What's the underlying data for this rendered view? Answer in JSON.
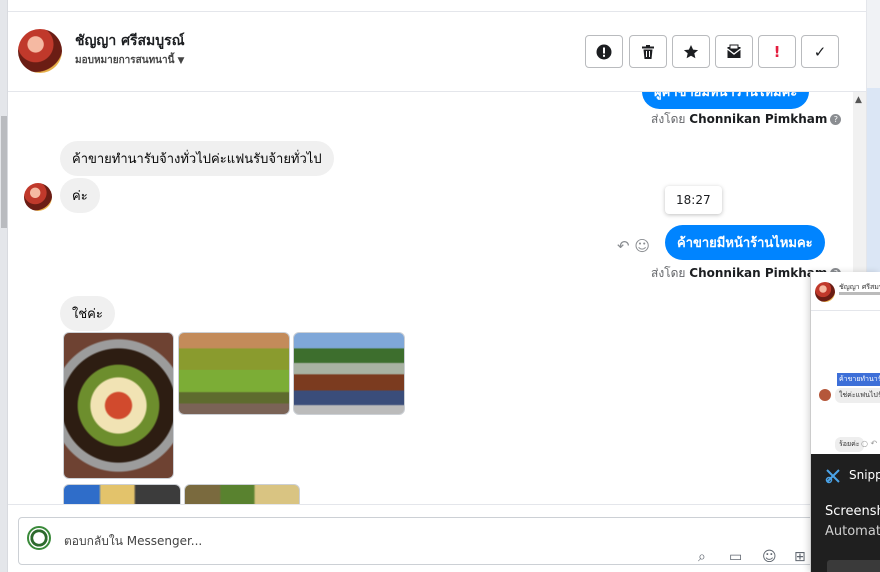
{
  "header": {
    "contact_name": "ชัญญา ศรีสมบูรณ์",
    "assign_label": "มอบหมายการสนทนานี้",
    "buttons": [
      {
        "name": "spam-button",
        "icon": "alert-circle-icon"
      },
      {
        "name": "delete-button",
        "icon": "trash-icon"
      },
      {
        "name": "star-button",
        "icon": "star-icon"
      },
      {
        "name": "mark-unread-button",
        "icon": "envelope-icon"
      },
      {
        "name": "follow-up-button",
        "icon": "exclamation-icon",
        "label": "!"
      },
      {
        "name": "done-button",
        "icon": "check-icon",
        "label": "✓"
      }
    ]
  },
  "messages": {
    "top_partial": "ผู้ค้าขายมีหน้าร้านไหมคะ",
    "sent_by_prefix": "ส่งโดย",
    "sent_by_name": "Chonnikan Pimkham",
    "incoming_1": "ค้าขายทำนารับจ้างทั่วไปค่ะแฟนรับจ้ายทั่วไป",
    "incoming_2": "ค่ะ",
    "timestamp": "18:27",
    "outgoing_2": "ค้าขายมีหน้าร้านไหมคะ",
    "incoming_3": "ใช่ค่ะ"
  },
  "composer": {
    "placeholder": "ตอบกลับใน Messenger...",
    "tools": [
      "attach-icon",
      "gif-icon",
      "emoji-icon",
      "more-icon"
    ]
  },
  "overlay": {
    "mini_name": "ชัญญา ศรีสมบู",
    "mini_highlight": "ค้าขายทำนารับ",
    "mini_reply": "ใช่ค่ะแฟนไปรับจ้าง",
    "mini_reply2": "ร้อยค่ะ",
    "snip_label": "Snipp",
    "toast_title": "Screensh",
    "toast_sub": "Automat"
  },
  "colors": {
    "accent": "#0084ff",
    "incoming_bubble": "#f0f0f0",
    "alert_red": "#e41e3f"
  }
}
